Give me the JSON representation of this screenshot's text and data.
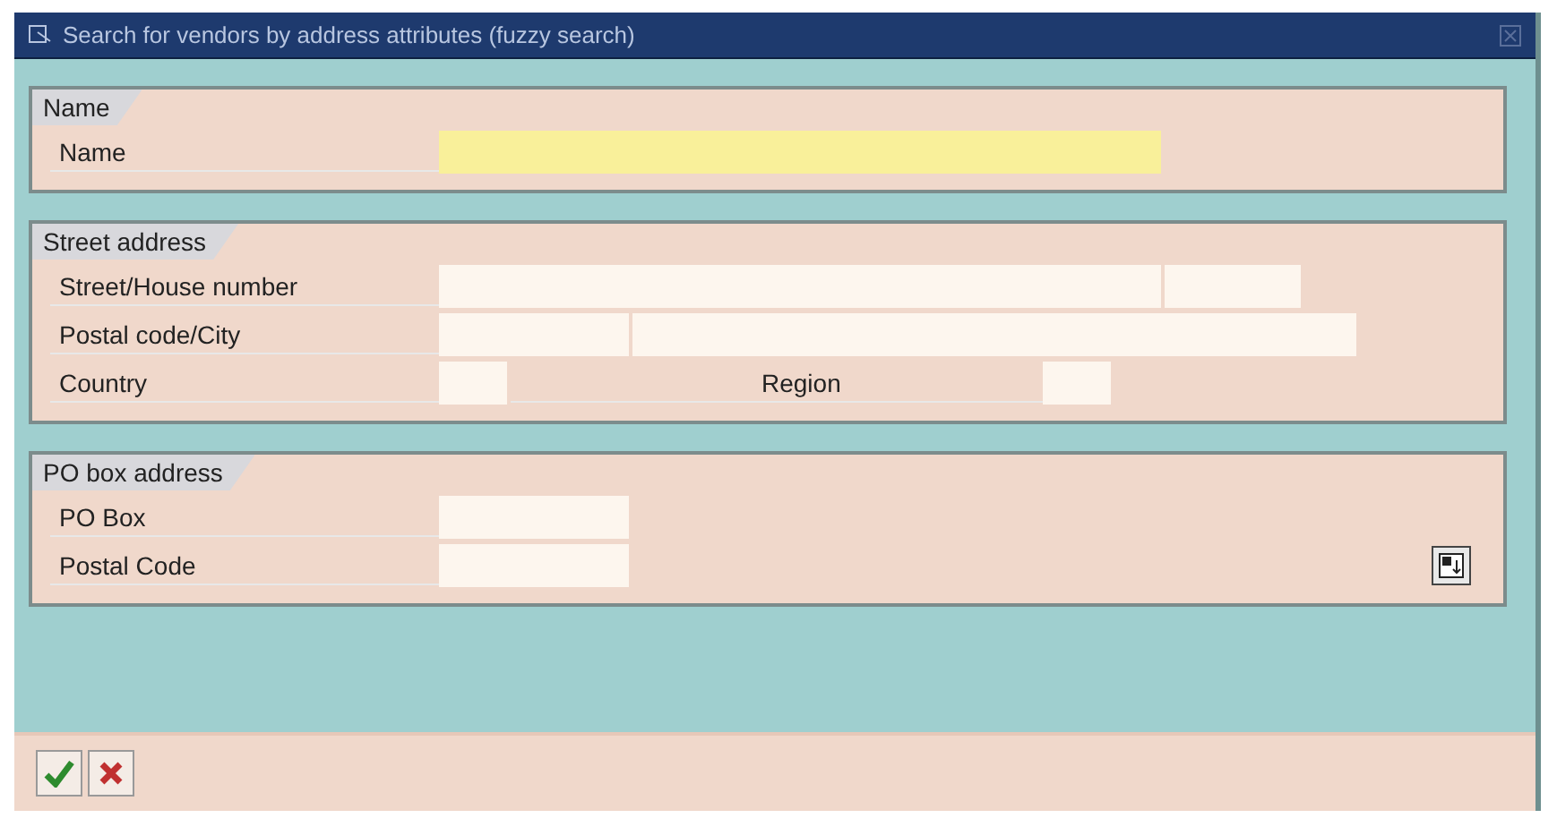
{
  "window": {
    "title": "Search for vendors by address attributes (fuzzy search)"
  },
  "sections": [
    {
      "title": "Name",
      "rows": [
        {
          "items": [
            {
              "kind": "label",
              "text": "Name"
            },
            {
              "kind": "field",
              "focused": true
            }
          ]
        }
      ]
    },
    {
      "title": "Street address",
      "rows": [
        {
          "items": [
            {
              "kind": "label",
              "text": "Street/House number"
            },
            {
              "kind": "field",
              "focused": false
            },
            {
              "kind": "field",
              "focused": false
            }
          ]
        },
        {
          "items": [
            {
              "kind": "label",
              "text": "Postal code/City"
            },
            {
              "kind": "field",
              "focused": false
            },
            {
              "kind": "field",
              "focused": false
            }
          ]
        },
        {
          "items": [
            {
              "kind": "label",
              "text": "Country"
            },
            {
              "kind": "field",
              "focused": false
            },
            {
              "kind": "label",
              "text": "Region"
            },
            {
              "kind": "field",
              "focused": false
            }
          ]
        }
      ]
    },
    {
      "title": "PO box address",
      "rows": [
        {
          "items": [
            {
              "kind": "label",
              "text": "PO Box"
            },
            {
              "kind": "field",
              "focused": false
            }
          ]
        },
        {
          "items": [
            {
              "kind": "label",
              "text": "Postal Code"
            },
            {
              "kind": "field",
              "focused": false
            }
          ]
        }
      ]
    }
  ],
  "footer_buttons": [
    {
      "kind": "confirm"
    },
    {
      "kind": "cancel"
    }
  ]
}
